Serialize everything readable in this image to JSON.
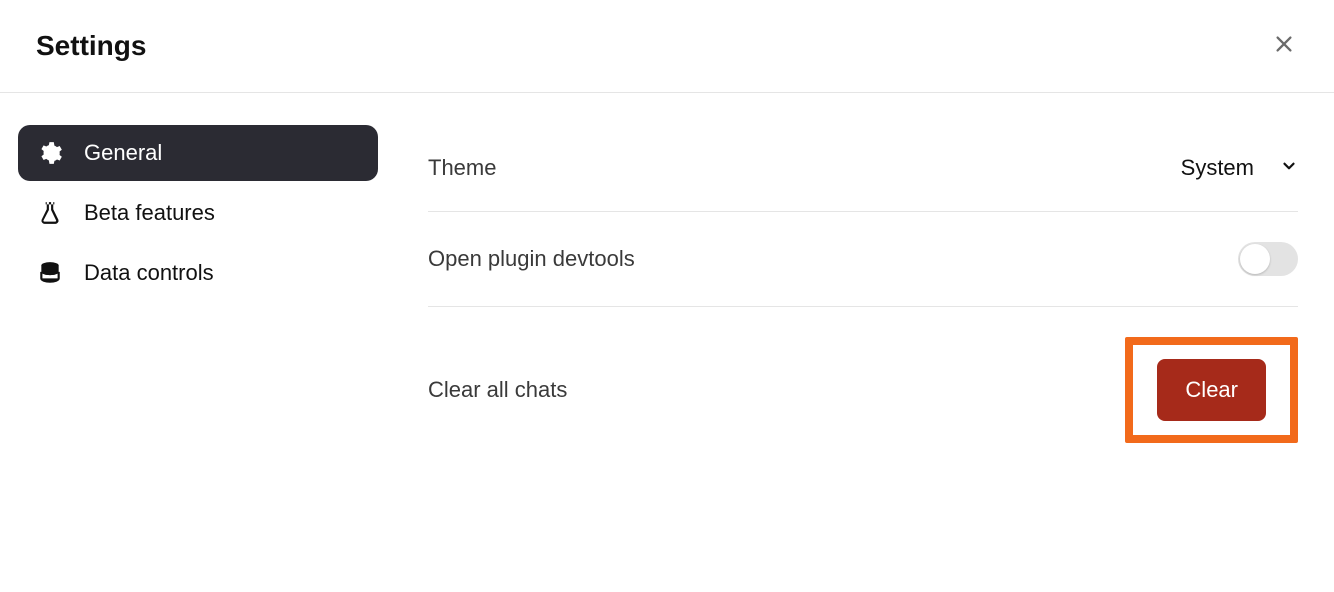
{
  "header": {
    "title": "Settings"
  },
  "sidebar": {
    "items": [
      {
        "label": "General"
      },
      {
        "label": "Beta features"
      },
      {
        "label": "Data controls"
      }
    ]
  },
  "content": {
    "theme": {
      "label": "Theme",
      "value": "System"
    },
    "devtools": {
      "label": "Open plugin devtools"
    },
    "clearChats": {
      "label": "Clear all chats",
      "button": "Clear"
    }
  }
}
